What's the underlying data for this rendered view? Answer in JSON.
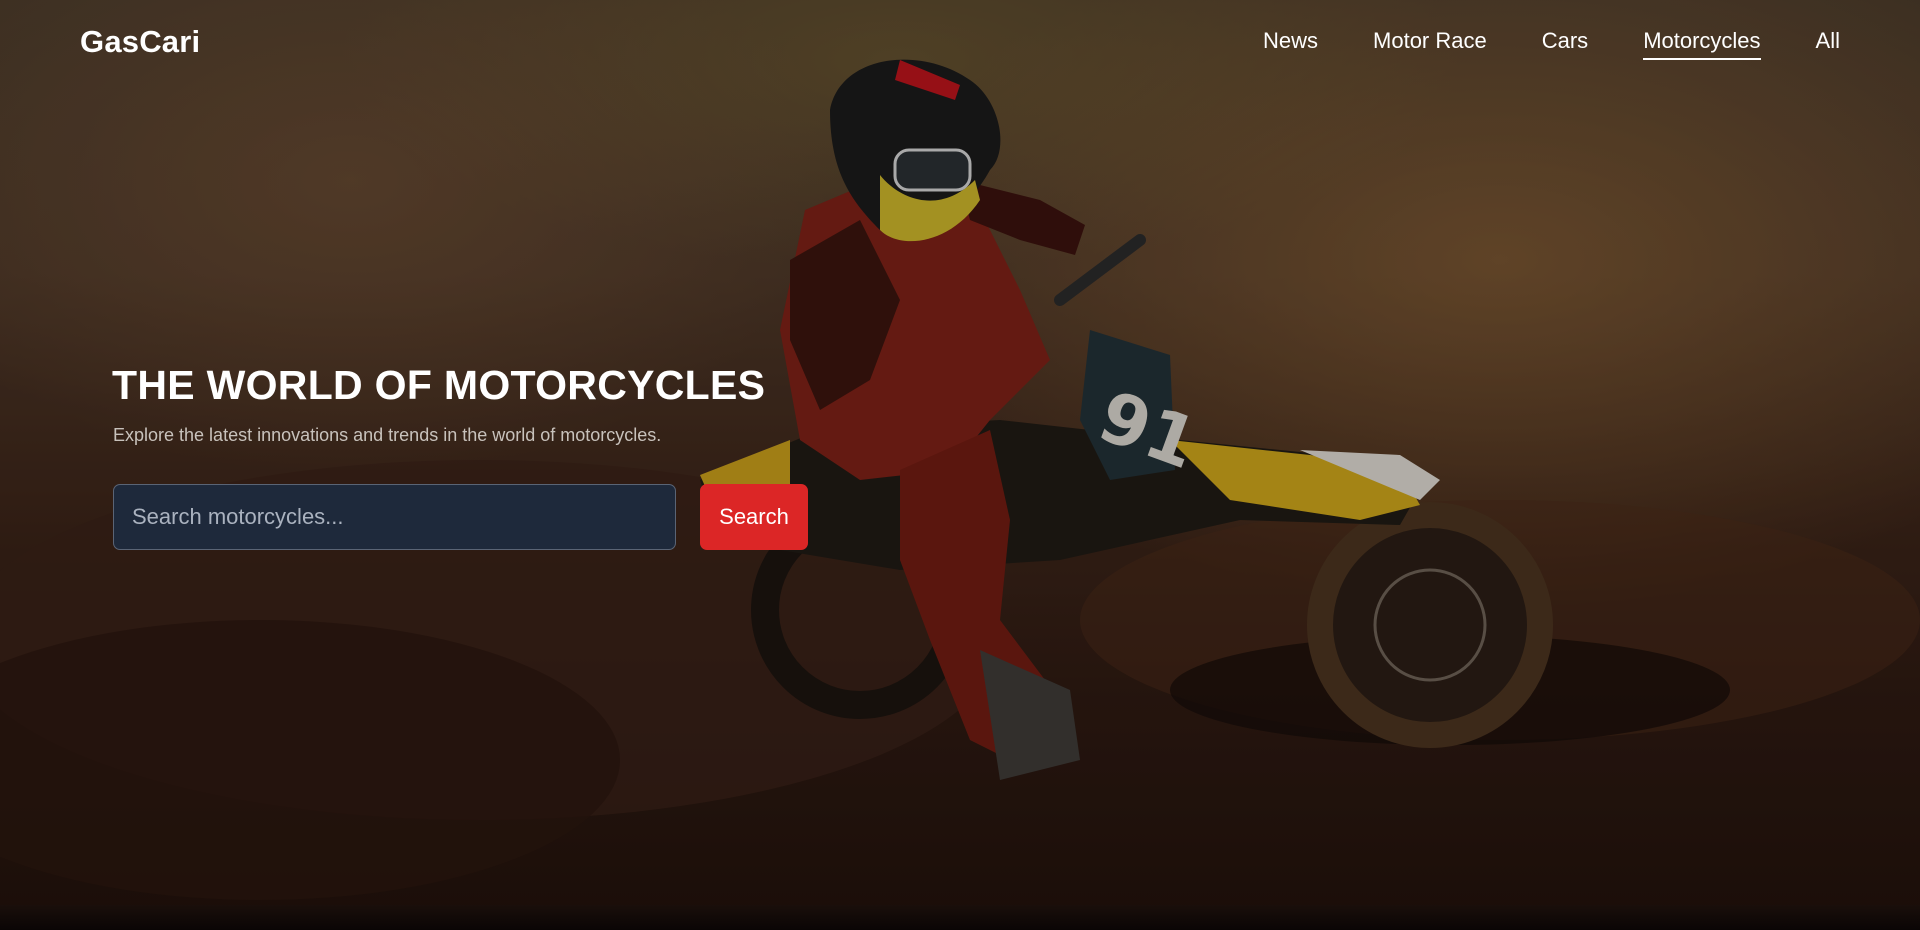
{
  "header": {
    "logo": "GasCari",
    "nav": [
      {
        "label": "News",
        "active": false
      },
      {
        "label": "Motor Race",
        "active": false
      },
      {
        "label": "Cars",
        "active": false
      },
      {
        "label": "Motorcycles",
        "active": true
      },
      {
        "label": "All",
        "active": false
      }
    ]
  },
  "hero": {
    "background_image": "motocross-rider-icon",
    "title": "THE WORLD OF MOTORCYCLES",
    "subtitle": "Explore the latest innovations and trends in the world of motorcycles.",
    "search": {
      "placeholder": "Search motorcycles...",
      "value": "",
      "button_label": "Search"
    }
  },
  "colors": {
    "accent": "#dc2626",
    "input_bg": "#1e293b",
    "text": "#ffffff"
  }
}
